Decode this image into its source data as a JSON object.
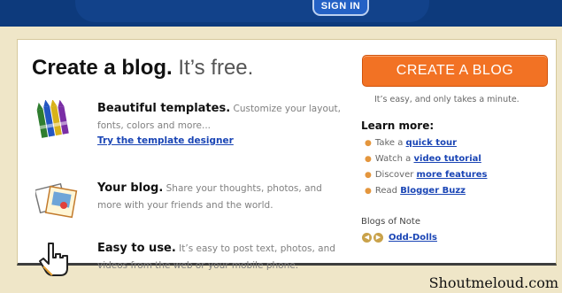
{
  "topbar": {
    "signin_label": "SIGN IN"
  },
  "headline": {
    "main": "Create a blog.",
    "sub": "It’s free."
  },
  "features": [
    {
      "title": "Beautiful templates.",
      "text": "Customize your layout, fonts, colors and more...",
      "link": "Try the template designer",
      "icon": "crayons-icon"
    },
    {
      "title": "Your blog.",
      "text": "Share your thoughts, photos, and more with your friends and the world.",
      "icon": "photos-icon"
    },
    {
      "title": "Easy to use.",
      "text": "It’s easy to post text, photos, and videos from the web or your mobile phone.",
      "icon": "hand-pointer-icon"
    }
  ],
  "cta": {
    "label": "CREATE A BLOG",
    "sub": "It’s easy, and only takes a minute."
  },
  "learn_more": {
    "title": "Learn more:",
    "items": [
      {
        "prefix": "Take a",
        "link": "quick tour"
      },
      {
        "prefix": "Watch a",
        "link": "video tutorial"
      },
      {
        "prefix": "Discover",
        "link": "more features"
      },
      {
        "prefix": "Read",
        "link": "Blogger Buzz"
      }
    ]
  },
  "blogs_of_note": {
    "title": "Blogs of Note",
    "link": "Odd-Dolls"
  },
  "watermark": "Shoutmeloud.com",
  "colors": {
    "accent": "#f27224",
    "link": "#1a45b5",
    "header": "#0d3a7c",
    "page_bg": "#efe6c8"
  }
}
